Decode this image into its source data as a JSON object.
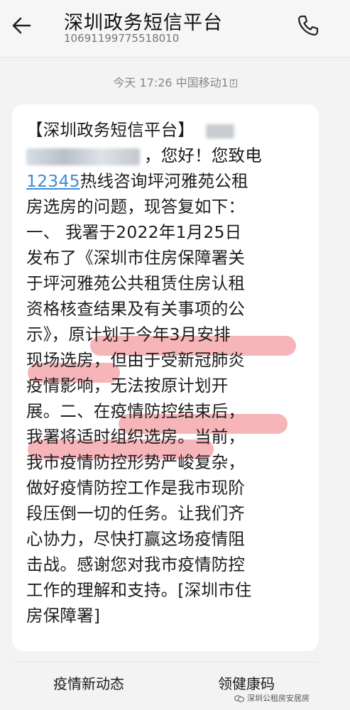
{
  "header": {
    "title": "深圳政务短信平台",
    "number": "10691199775518010"
  },
  "timestamp": {
    "text": "今天 17:26 中国移动1",
    "sim": "1"
  },
  "message": {
    "lines": [
      "【深圳政务短信平台】",
      "，您好！您致电",
      "12345",
      "热线咨询坪河雅苑公租",
      "房选房的问题，现答复如下：",
      "一、  我署于2022年1月25日",
      "发布了《深圳市住房保障署关",
      "于坪河雅苑公共租赁住房认租",
      "资格核查结果及有关事项的公",
      "示》，原计划于今年3月安排",
      "现场选房，但由于受新冠肺炎",
      "疫情影响，无法按原计划开",
      "展。二、在疫情防控结束后，",
      "我署将适时组织选房。当前，",
      "我市疫情防控形势严峻复杂，",
      "做好疫情防控工作是我市现阶",
      "段压倒一切的任务。让我们齐",
      "心协力，尽快打赢这场疫情阻",
      "击战。感谢您对我市疫情防控",
      "工作的理解和支持。[深圳市住",
      "房保障署]"
    ]
  },
  "quick_replies": [
    "疫情新动态",
    "领健康码"
  ],
  "watermark": "深圳公租房安居房",
  "colors": {
    "link": "#3f8bd6",
    "highlight": "#f3a0a5",
    "background": "#f3f3f3"
  }
}
